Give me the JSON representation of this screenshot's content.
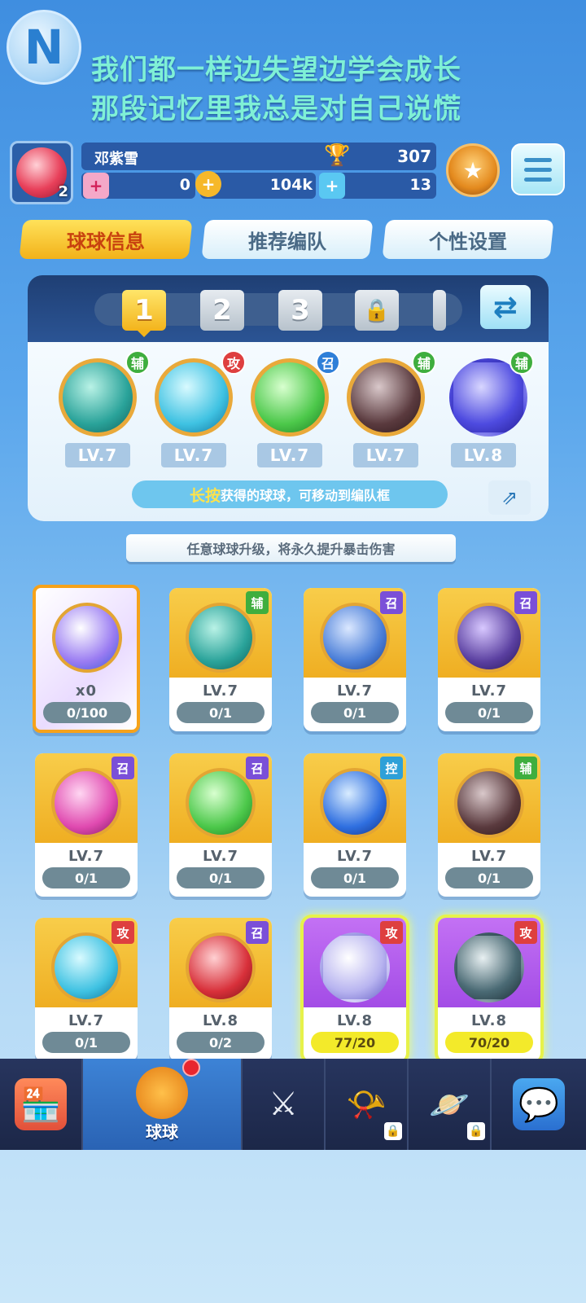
{
  "lyrics": [
    "我们都一样边失望边学会成长",
    "那段记忆里我总是对自己说慌"
  ],
  "profile": {
    "name": "邓紫雪",
    "avatar_level": "2",
    "trophies": "307",
    "coupons": "0",
    "coins": "104k",
    "gems": "13"
  },
  "tabs": [
    "球球信息",
    "推荐编队",
    "个性设置"
  ],
  "team": {
    "slots": [
      "1",
      "2",
      "3"
    ],
    "balls": [
      {
        "badge": "辅",
        "level": "LV.7",
        "color": "#2aa39a"
      },
      {
        "badge": "攻",
        "level": "LV.7",
        "color": "#3fc2e2"
      },
      {
        "badge": "召",
        "level": "LV.7",
        "color": "#4cc84a"
      },
      {
        "badge": "辅",
        "level": "LV.7",
        "color": "#5a3a3e"
      },
      {
        "badge": "辅",
        "level": "LV.8",
        "color": "#4e4be0"
      }
    ],
    "hint_highlight": "长按",
    "hint_text": "获得的球球，可移动到编队框"
  },
  "notice": "任意球球升级，将永久提升暴击伤害",
  "cards": [
    {
      "badge": "",
      "level": "x0",
      "progress": "0/100",
      "style": "special",
      "color": "#9a7cf2"
    },
    {
      "badge": "辅",
      "level": "LV.7",
      "progress": "0/1",
      "style": "gold",
      "color": "#2aa39a"
    },
    {
      "badge": "召",
      "level": "LV.7",
      "progress": "0/1",
      "style": "gold",
      "color": "#4a7ed8"
    },
    {
      "badge": "召",
      "level": "LV.7",
      "progress": "0/1",
      "style": "gold",
      "color": "#5a3fa0"
    },
    {
      "badge": "召",
      "level": "LV.7",
      "progress": "0/1",
      "style": "gold",
      "color": "#e04ab0"
    },
    {
      "badge": "召",
      "level": "LV.7",
      "progress": "0/1",
      "style": "gold",
      "color": "#4cc84a"
    },
    {
      "badge": "控",
      "level": "LV.7",
      "progress": "0/1",
      "style": "gold",
      "color": "#2f6fe0"
    },
    {
      "badge": "辅",
      "level": "LV.7",
      "progress": "0/1",
      "style": "gold",
      "color": "#5a3a3e"
    },
    {
      "badge": "攻",
      "level": "LV.7",
      "progress": "0/1",
      "style": "gold",
      "color": "#3fc2e2"
    },
    {
      "badge": "召",
      "level": "LV.8",
      "progress": "0/2",
      "style": "gold",
      "color": "#d8303a"
    },
    {
      "badge": "攻",
      "level": "LV.8",
      "progress": "77/20",
      "style": "purple",
      "color": "#b8b4f0"
    },
    {
      "badge": "攻",
      "level": "LV.8",
      "progress": "70/20",
      "style": "purple",
      "color": "#4a6a74"
    }
  ],
  "nav": {
    "active_label": "球球"
  }
}
